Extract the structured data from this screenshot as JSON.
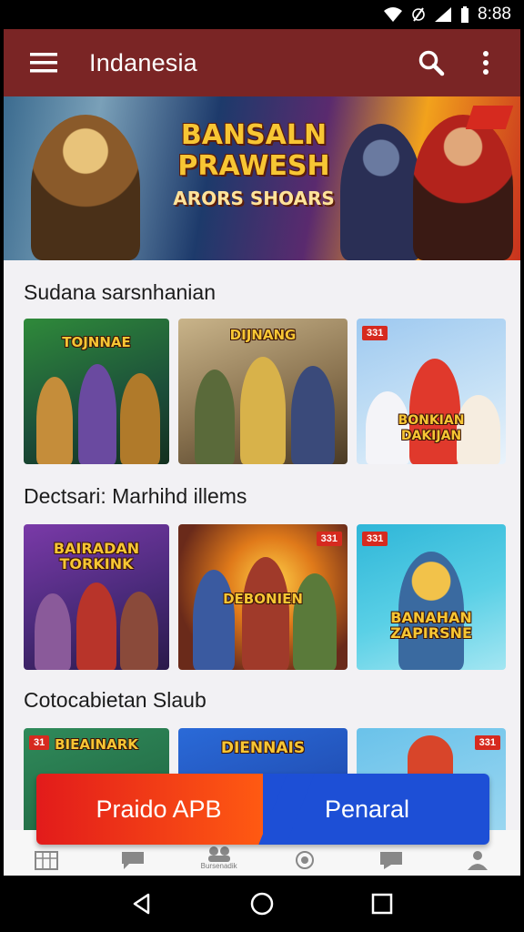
{
  "status_bar": {
    "time": "8:88"
  },
  "toolbar": {
    "title": "Indanesia"
  },
  "banner": {
    "line1": "BANSALN",
    "line2": "PRAWESH",
    "line3": "ARORS SHOARS",
    "flag": ""
  },
  "sections": [
    {
      "title": "Sudana sarsnhanian",
      "cards": [
        {
          "title": "TOJNNAE",
          "badge": ""
        },
        {
          "title": "DIJNANG",
          "badge": ""
        },
        {
          "title": "BONKIAN\nDAKIJAN",
          "badge": "331"
        }
      ]
    },
    {
      "title": "Dectsari: Marhihd illems",
      "cards": [
        {
          "title": "BAIRADAN\nTORKINK",
          "badge": ""
        },
        {
          "title": "DEBONIEN",
          "badge": "331"
        },
        {
          "title": "BANAHAN\nZAPIRSNE",
          "badge": "331"
        }
      ]
    },
    {
      "title": "Cotocabietan Slaub",
      "cards": [
        {
          "title": "BIEAINARK",
          "badge": "31"
        },
        {
          "title": "DIENNAIS",
          "badge": ""
        },
        {
          "title": "",
          "badge": "331"
        }
      ]
    }
  ],
  "cta": {
    "left_label": "Praido APB",
    "right_label": "Penaral"
  },
  "bottom_nav": {
    "center_label": "Bursenadik"
  },
  "colors": {
    "toolbar": "#7a2525",
    "cta_left": "#e21b1b",
    "cta_right": "#1d4fd6",
    "badge": "#d62a1f",
    "title_gold": "#f7c634"
  }
}
